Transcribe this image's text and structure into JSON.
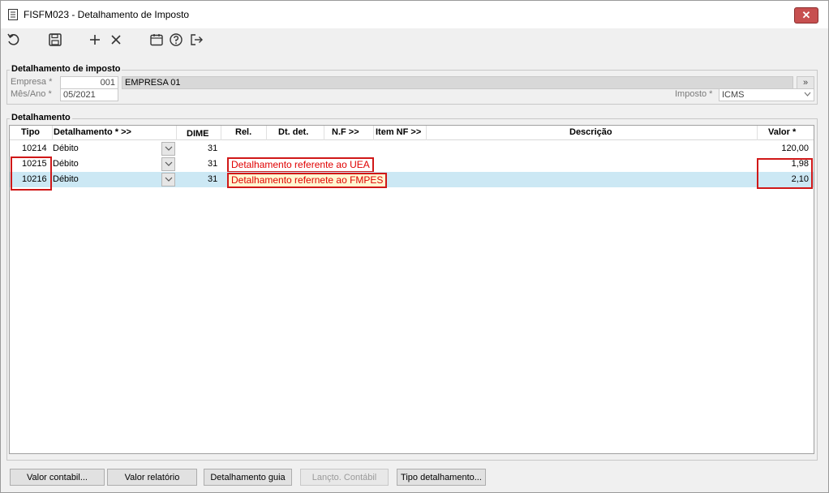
{
  "window": {
    "title": "FISFM023 - Detalhamento de Imposto",
    "close_label": "✕"
  },
  "toolbar": {
    "icons": [
      "undo-icon",
      "save-icon",
      "add-icon",
      "delete-icon",
      "calendar-icon",
      "help-icon",
      "exit-icon"
    ]
  },
  "detalhamento_imposto": {
    "group_title": "Detalhamento de imposto",
    "empresa_label": "Empresa *",
    "empresa_code": "001",
    "empresa_name": "EMPRESA 01",
    "lookup_label": "»",
    "mes_ano_label": "Mês/Ano *",
    "mes_ano_value": "05/2021",
    "imposto_label": "Imposto *",
    "imposto_value": "ICMS"
  },
  "detalhamento": {
    "group_title": "Detalhamento",
    "columns": {
      "tipo": "Tipo",
      "detalhamento": "Detalhamento * >>",
      "dime": "DIME",
      "rel": "Rel.",
      "dt_det": "Dt. det.",
      "nf": "N.F >>",
      "item_nf": "Item NF >>",
      "descricao": "Descrição",
      "valor": "Valor *"
    },
    "rows": [
      {
        "tipo": "10214",
        "detalhamento": "Débito",
        "dime": "31",
        "descricao": "",
        "valor": "120,00"
      },
      {
        "tipo": "10215",
        "detalhamento": "Débito",
        "dime": "31",
        "descricao": "Detalhamento referente ao UEA",
        "valor": "1,98"
      },
      {
        "tipo": "10216",
        "detalhamento": "Débito",
        "dime": "31",
        "descricao": "Detalhamento refernete ao FMPES",
        "valor": "2,10"
      }
    ]
  },
  "buttons": {
    "valor_contabil": "Valor contabil...",
    "valor_relatorio": "Valor relatório",
    "detalhamento_guia": "Detalhamento guia",
    "lancto_contabil": "Lançto. Contábil",
    "tipo_detalhamento": "Tipo detalhamento..."
  },
  "colors": {
    "selected_row": "#cce8f4",
    "annotation_red": "#d01818",
    "close_button": "#c75050"
  }
}
